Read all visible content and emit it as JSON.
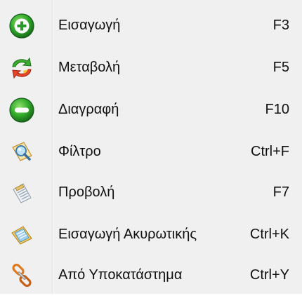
{
  "menu": {
    "items": [
      {
        "label": "Εισαγωγή",
        "shortcut": "F3",
        "icon": "add-icon"
      },
      {
        "label": "Μεταβολή",
        "shortcut": "F5",
        "icon": "refresh-icon"
      },
      {
        "label": "Διαγραφή",
        "shortcut": "F10",
        "icon": "remove-icon"
      },
      {
        "label": "Φίλτρο",
        "shortcut": "Ctrl+F",
        "icon": "filter-icon"
      },
      {
        "label": "Προβολή",
        "shortcut": "F7",
        "icon": "view-icon"
      },
      {
        "label": "Εισαγωγή Ακυρωτικής",
        "shortcut": "Ctrl+K",
        "icon": "cancel-entry-icon"
      },
      {
        "label": "Από Υποκατάστημα",
        "shortcut": "Ctrl+Y",
        "icon": "branch-link-icon"
      }
    ]
  }
}
